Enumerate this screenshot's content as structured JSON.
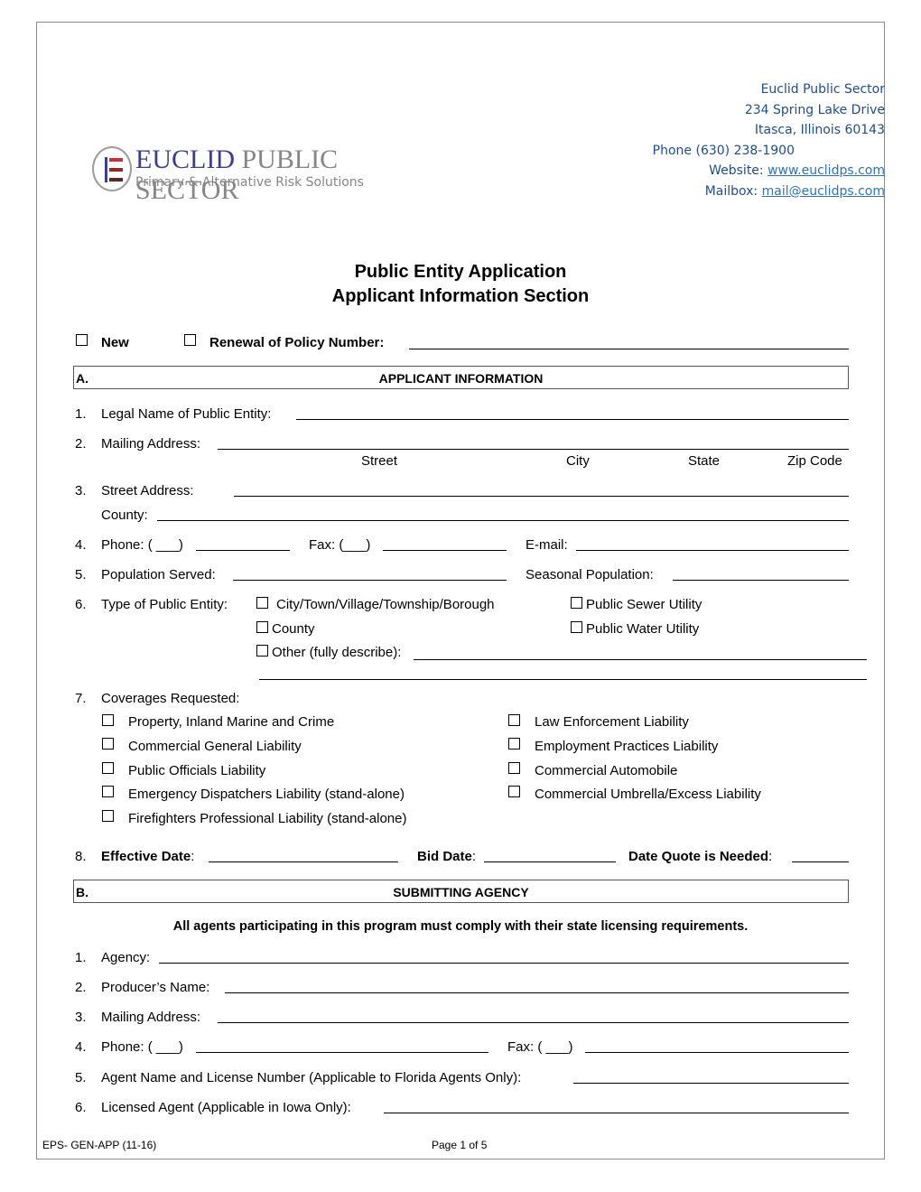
{
  "header": {
    "logo": {
      "brand_part1": "EUCLID",
      "brand_part2": "PUBLIC SECTOR",
      "tagline": "Primary & Alternative Risk Solutions",
      "icon": "euclid-e-logo-icon",
      "colors": {
        "navy": "#3b3f8c",
        "gray": "#8a8585",
        "red": "#c8303a",
        "maroon": "#8b2a2a",
        "brown": "#5a2a20"
      }
    },
    "contact": {
      "company": "Euclid Public Sector",
      "street": "234 Spring Lake Drive",
      "city_state_zip": "Itasca, Illinois 60143",
      "phone": "Phone (630) 238-1900",
      "website_label": "Website: ",
      "website": "www.euclidps.com",
      "mailbox_label": "Mailbox: ",
      "mailbox": "mail@euclidps.com",
      "text_color": "#1f4e8c",
      "link_color": "#2e74b5"
    }
  },
  "title": {
    "line1": "Public Entity Application",
    "line2": "Applicant Information Section"
  },
  "policy_type": {
    "new_label": "New",
    "renewal_label": "Renewal of Policy Number:",
    "new_checked": false,
    "renewal_checked": false,
    "policy_number": ""
  },
  "section_a": {
    "letter": "A.",
    "heading": "APPLICANT INFORMATION",
    "items": {
      "legal_name": {
        "num": "1.",
        "label": "Legal Name of Public Entity:",
        "value": ""
      },
      "mailing": {
        "num": "2.",
        "label": "Mailing Address:",
        "value": "",
        "sub_labels": [
          "Street",
          "City",
          "State",
          "Zip Code"
        ]
      },
      "street": {
        "num": "3.",
        "label": "Street Address:",
        "value": ""
      },
      "county": {
        "label": "County:",
        "value": ""
      },
      "phone": {
        "num": "4.",
        "label": "Phone: ( ___)",
        "value": ""
      },
      "fax": {
        "label": "Fax: (___)",
        "value": ""
      },
      "email": {
        "label": "E-mail:",
        "value": ""
      },
      "population": {
        "num": "5.",
        "label": "Population Served:",
        "value": ""
      },
      "seasonal": {
        "label": "Seasonal Population:",
        "value": ""
      },
      "entity_type": {
        "num": "6.",
        "label": "Type of Public Entity:",
        "options": [
          {
            "label": "City/Town/Village/Township/Borough",
            "checked": false
          },
          {
            "label": "Public Sewer Utility",
            "checked": false
          },
          {
            "label": "County",
            "checked": false
          },
          {
            "label": "Public Water Utility",
            "checked": false
          },
          {
            "label": "Other (fully describe):",
            "checked": false
          }
        ],
        "other_value": ""
      },
      "coverages": {
        "num": "7.",
        "label": "Coverages Requested:",
        "left": [
          {
            "label": "Property, Inland Marine and Crime",
            "checked": false
          },
          {
            "label": "Commercial General Liability",
            "checked": false
          },
          {
            "label": "Public Officials Liability",
            "checked": false
          },
          {
            "label": "Emergency Dispatchers Liability (stand-alone)",
            "checked": false
          },
          {
            "label": "Firefighters Professional Liability (stand-alone)",
            "checked": false
          }
        ],
        "right": [
          {
            "label": "Law Enforcement Liability",
            "checked": false
          },
          {
            "label": "Employment Practices Liability",
            "checked": false
          },
          {
            "label": "Commercial Automobile",
            "checked": false
          },
          {
            "label": "Commercial Umbrella/Excess Liability",
            "checked": false
          }
        ]
      },
      "dates": {
        "num": "8.",
        "effective_label": "Effective Date",
        "bid_label": "Bid Date",
        "quote_label": "Date Quote is Needed",
        "colon": ":",
        "effective_value": "",
        "bid_value": "",
        "quote_value": ""
      }
    }
  },
  "section_b": {
    "letter": "B.",
    "heading": "SUBMITTING AGENCY",
    "notice": "All agents participating in this program must comply with their state licensing requirements.",
    "items": {
      "agency": {
        "num": "1.",
        "label": "Agency:",
        "value": ""
      },
      "producer": {
        "num": "2.",
        "label": "Producer’s Name:",
        "value": ""
      },
      "mailing": {
        "num": "3.",
        "label": "Mailing Address:",
        "value": ""
      },
      "phone": {
        "num": "4.",
        "label": "Phone: ( ___)",
        "value": ""
      },
      "fax": {
        "label": "Fax: ( ___)",
        "value": ""
      },
      "florida": {
        "num": "5.",
        "label": "Agent Name and License Number (Applicable to Florida Agents Only):",
        "value": ""
      },
      "iowa": {
        "num": "6.",
        "label": "Licensed Agent (Applicable in Iowa Only):",
        "value": ""
      }
    }
  },
  "footer": {
    "form_id": "EPS- GEN-APP (11-16)",
    "page": "Page 1 of 5"
  }
}
